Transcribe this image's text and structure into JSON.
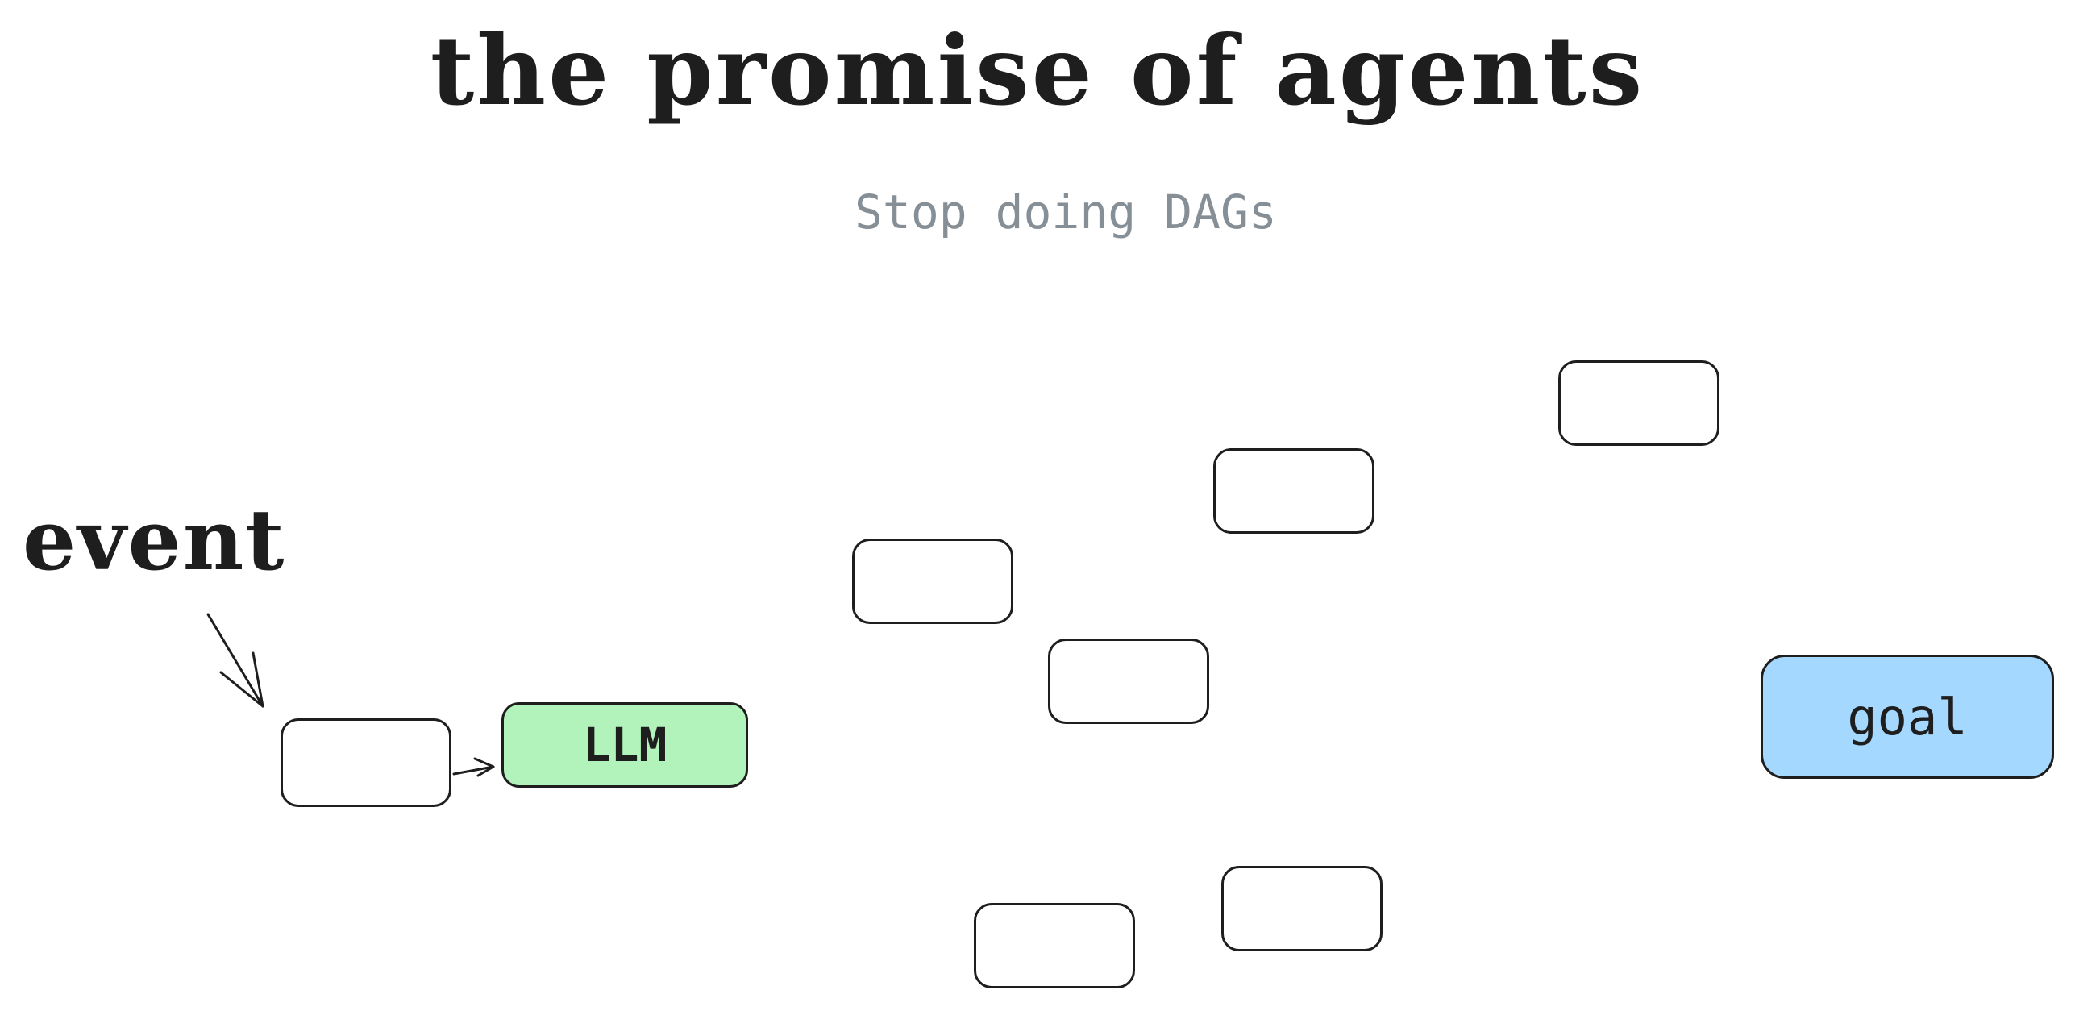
{
  "header": {
    "title": "the promise of agents",
    "subtitle": "Stop doing DAGs"
  },
  "diagram": {
    "event_label": "event",
    "llm_label": "LLM",
    "goal_label": "goal"
  },
  "colors": {
    "stroke": "#1e1e1e",
    "llm_fill": "#b2f2bb",
    "goal_fill": "#a5d8ff",
    "subtitle": "#868e96"
  }
}
